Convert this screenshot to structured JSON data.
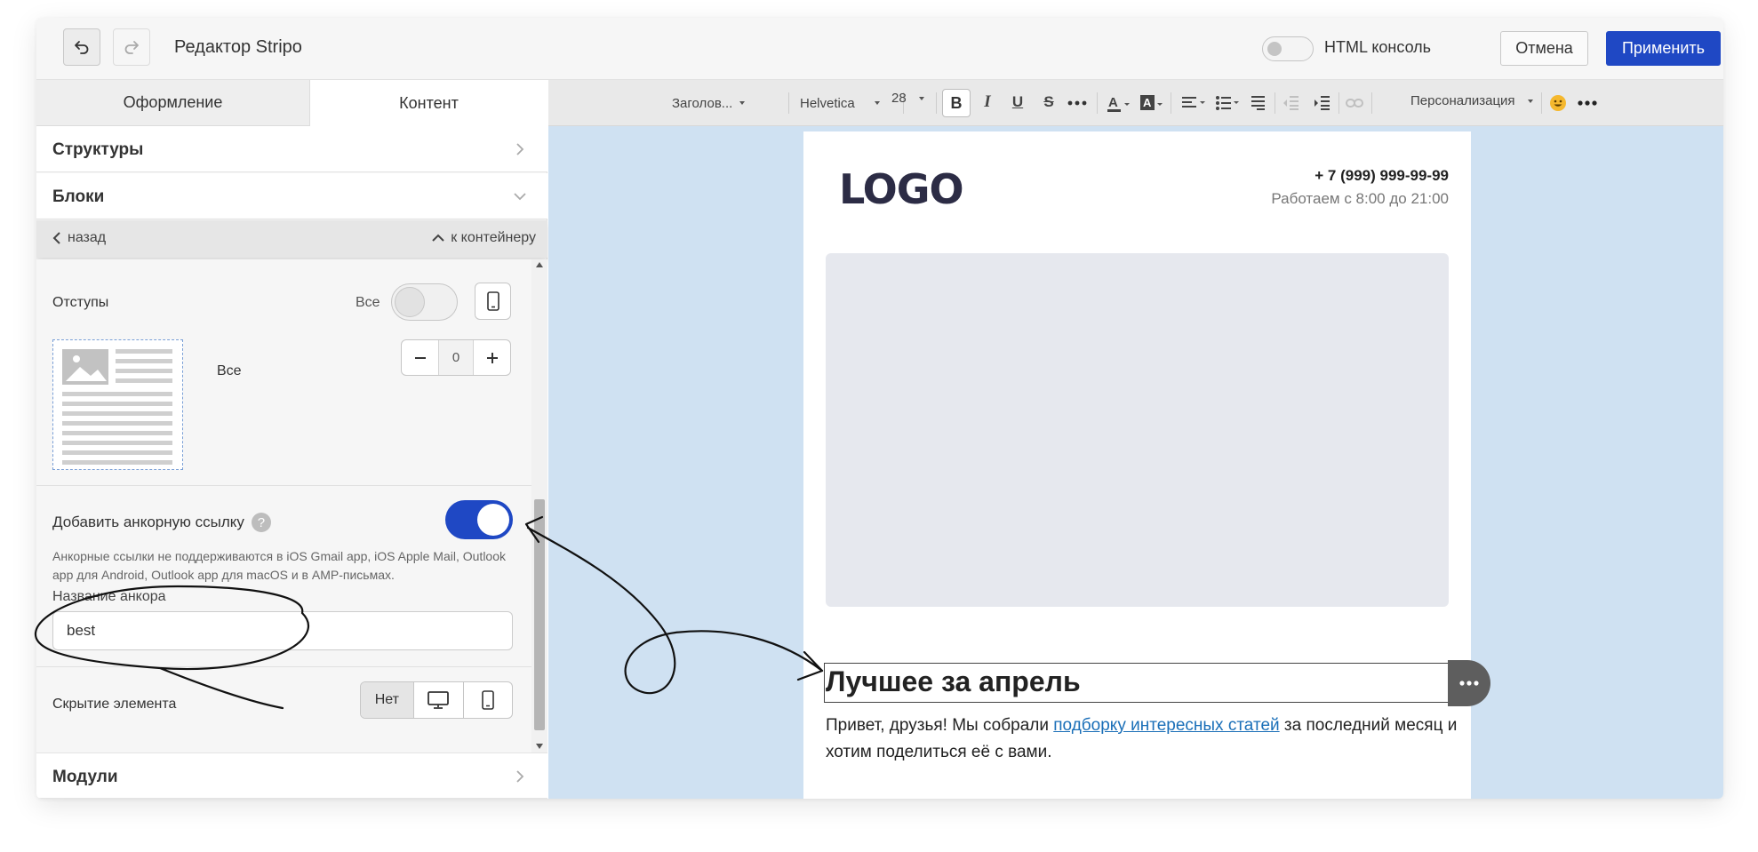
{
  "topbar": {
    "title": "Редактор Stripo",
    "undo_icon": "undo-icon",
    "redo_icon": "redo-icon",
    "html_console_label": "HTML консоль",
    "cancel_label": "Отмена",
    "apply_label": "Применить",
    "apply_color": "#1f48c4"
  },
  "left_panel": {
    "tabs": [
      "Оформление",
      "Контент"
    ],
    "active_tab": "Контент",
    "sections": {
      "structures": "Структуры",
      "blocks": "Блоки",
      "modules": "Модули"
    },
    "nav": {
      "back": "назад",
      "to_container": "к контейнеру"
    },
    "padding": {
      "label": "Отступы",
      "all_label": "Все",
      "all_label_2": "Все",
      "value": "0"
    },
    "anchor": {
      "label": "Добавить анкорную ссылку",
      "help": "?",
      "enabled": true,
      "note": "Анкорные ссылки не поддерживаются в iOS Gmail app, iOS Apple Mail, Outlook app для Android, Outlook app для macOS и в AMP-письмах.",
      "name_label": "Название анкора",
      "name_value": "best"
    },
    "hide_element": {
      "label": "Скрытие элемента",
      "options": [
        "Нет",
        "desktop-icon",
        "mobile-icon"
      ],
      "selected": "Нет"
    }
  },
  "toolbar": {
    "block_format": "Заголов...",
    "font": "Helvetica",
    "size": "28",
    "personalization": "Персонализация",
    "bold": "B",
    "italic": "I",
    "underline": "U",
    "strike": "S"
  },
  "email": {
    "logo": "LOGO",
    "phone": "+ 7 (999) 999-99-99",
    "hours": "Работаем с 8:00 до 21:00",
    "headline": "Лучшее за апрель",
    "body_before": "Привет, друзья! Мы собрали ",
    "body_link": "подборку интересных статей",
    "body_after": " за последний месяц и хотим поделиться её с вами."
  },
  "colors": {
    "canvas_bg": "#cfe1f2",
    "accent": "#1f48c4",
    "link": "#1a6fb8"
  }
}
